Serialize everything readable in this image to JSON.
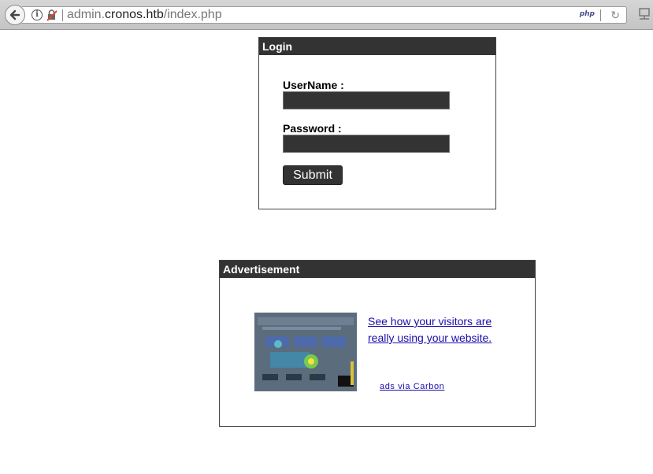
{
  "browser": {
    "url_prefix": "admin.",
    "url_host": "cronos.htb",
    "url_path": "/index.php",
    "php_badge": "php",
    "info_glyph": "i",
    "reload_glyph": "↻"
  },
  "login": {
    "title": "Login",
    "username_label": "UserName :",
    "username_value": "",
    "password_label": "Password :",
    "password_value": "",
    "submit_label": "Submit"
  },
  "advertisement": {
    "title": "Advertisement",
    "link_text": "See how your visitors are really using your website.",
    "via_text": "ads via Carbon"
  },
  "colors": {
    "panel_header": "#333333",
    "input_bg": "#333333",
    "link": "#1a0dab"
  }
}
